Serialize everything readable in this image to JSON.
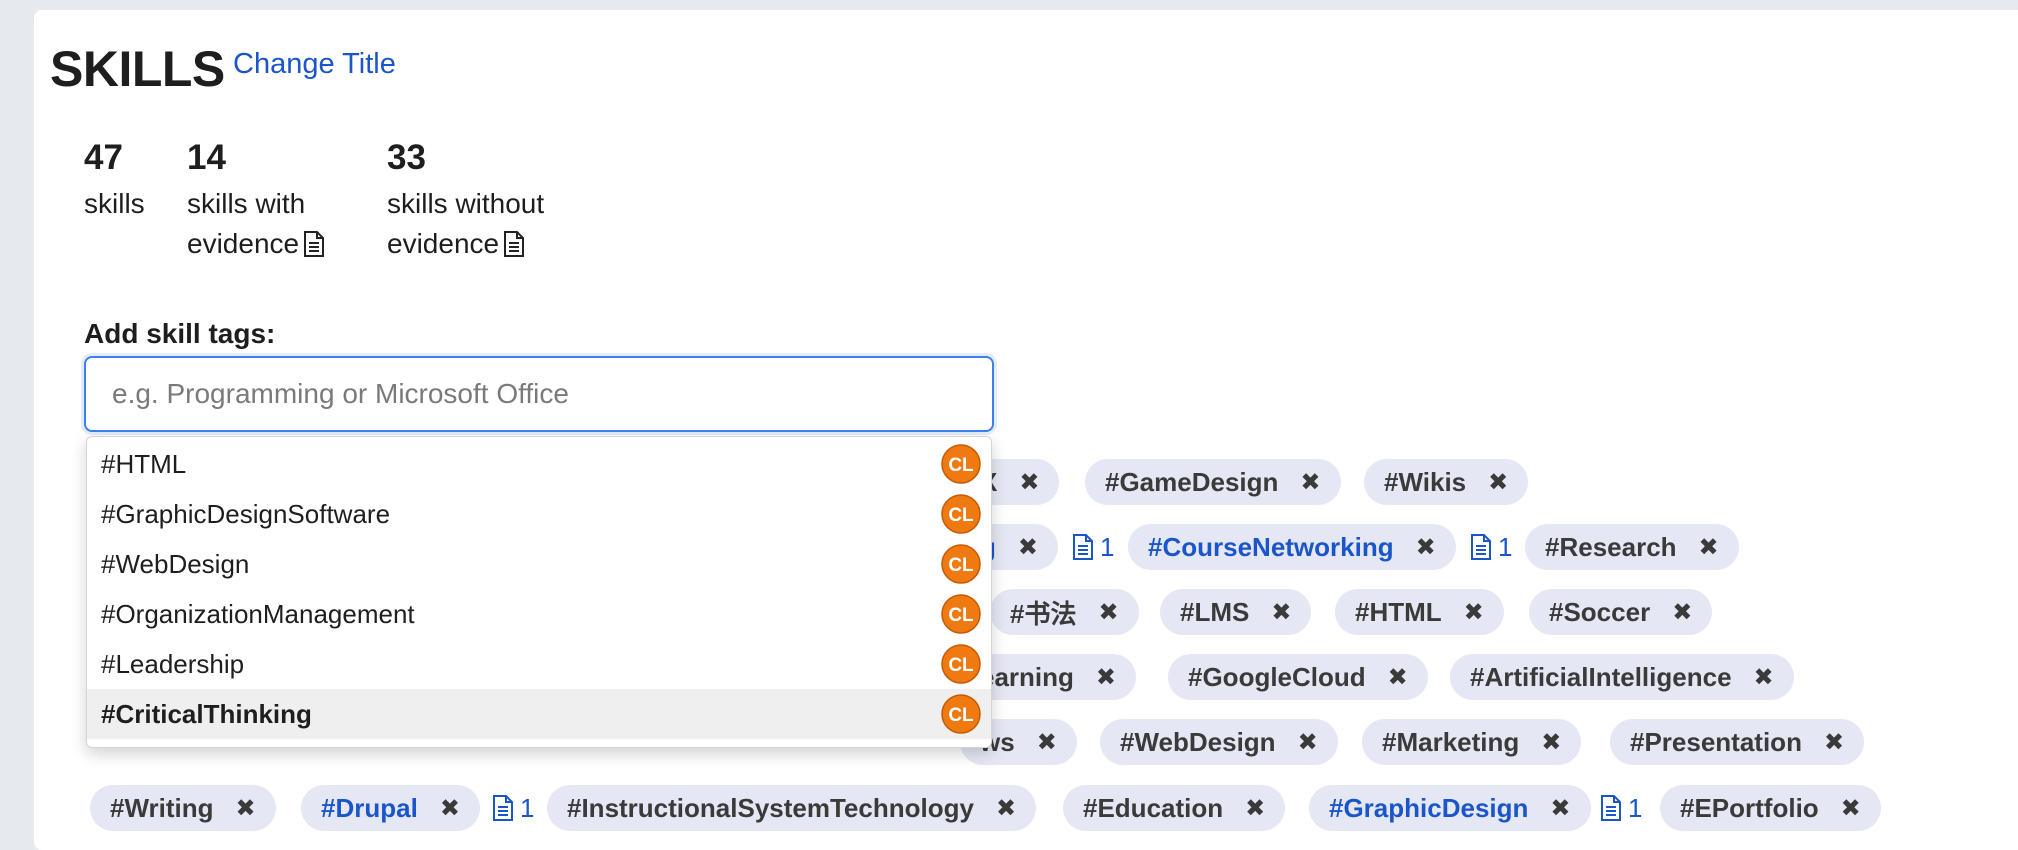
{
  "header": {
    "title": "SKILLS",
    "change_title": "Change Title"
  },
  "stats": [
    {
      "value": "47",
      "label_line1": "skills",
      "label_line2": ""
    },
    {
      "value": "14",
      "label_line1": "skills with",
      "label_line2": "evidence"
    },
    {
      "value": "33",
      "label_line1": "skills without",
      "label_line2": "evidence"
    }
  ],
  "add": {
    "label": "Add skill tags:",
    "placeholder": "e.g. Programming or Microsoft Office"
  },
  "suggestions": [
    {
      "text": "#HTML",
      "badge": "CL"
    },
    {
      "text": "#GraphicDesignSoftware",
      "badge": "CL"
    },
    {
      "text": "#WebDesign",
      "badge": "CL"
    },
    {
      "text": "#OrganizationManagement",
      "badge": "CL"
    },
    {
      "text": "#Leadership",
      "badge": "CL"
    },
    {
      "text": "#CriticalThinking",
      "badge": "CL"
    }
  ],
  "tags": {
    "row1": [
      {
        "text": "X"
      },
      {
        "text": "#GameDesign"
      },
      {
        "text": "#Wikis"
      }
    ],
    "row2": [
      {
        "text": "g",
        "evidence": "1"
      },
      {
        "text": "#CourseNetworking",
        "evidence": "1"
      },
      {
        "text": "#Research"
      }
    ],
    "row3": [
      {
        "text": "#书法"
      },
      {
        "text": "#LMS"
      },
      {
        "text": "#HTML"
      },
      {
        "text": "#Soccer"
      }
    ],
    "row4": [
      {
        "text": "earning"
      },
      {
        "text": "#GoogleCloud"
      },
      {
        "text": "#ArtificialIntelligence"
      }
    ],
    "row5": [
      {
        "text": "ws"
      },
      {
        "text": "#WebDesign"
      },
      {
        "text": "#Marketing"
      },
      {
        "text": "#Presentation"
      }
    ],
    "row6": [
      {
        "text": "#Writing"
      },
      {
        "text": "#Drupal",
        "evidence": "1"
      },
      {
        "text": "#InstructionalSystemTechnology"
      },
      {
        "text": "#Education"
      },
      {
        "text": "#GraphicDesign",
        "evidence": "1"
      },
      {
        "text": "#EPortfolio"
      }
    ]
  },
  "remove_symbol": "✖",
  "colors": {
    "link": "#1a56c9",
    "tag_bg": "#e5e7f4",
    "focus": "#3d80f0",
    "cl_orange": "#f07a12"
  }
}
